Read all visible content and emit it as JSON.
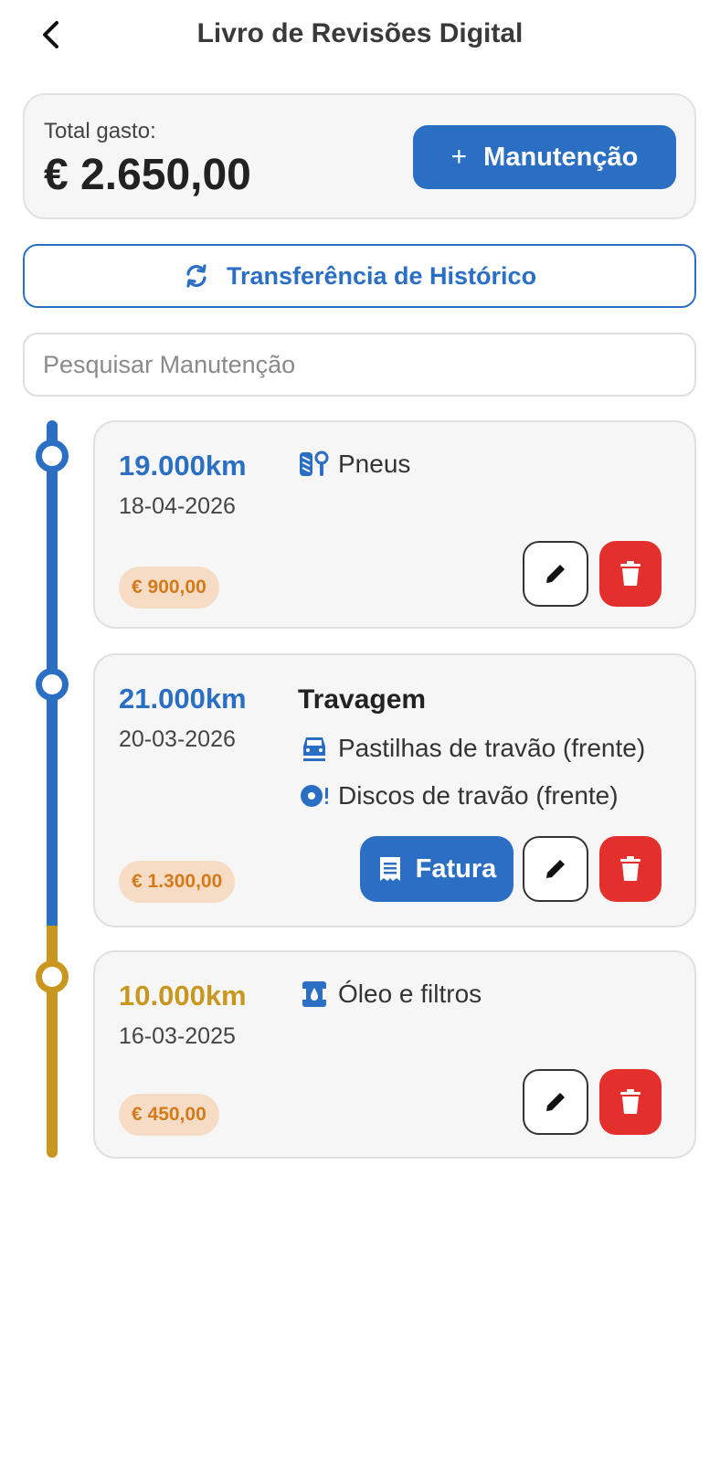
{
  "header": {
    "title": "Livro de Revisões Digital"
  },
  "summary": {
    "total_label": "Total gasto:",
    "total_value": "€ 2.650,00",
    "add_label": "Manutenção"
  },
  "transfer": {
    "label": "Transferência de Histórico"
  },
  "search": {
    "placeholder": "Pesquisar Manutenção",
    "value": ""
  },
  "colors": {
    "primary": "#2a6fc4",
    "gold": "#c9971e",
    "danger": "#e3302c",
    "price_bg": "#f7dcc5",
    "price_text": "#d37a1b"
  },
  "records": [
    {
      "km": "19.000km",
      "date": "18-04-2026",
      "items": [
        {
          "icon": "tire-wrench-icon",
          "label": "Pneus"
        }
      ],
      "price": "€ 900,00"
    },
    {
      "km": "21.000km",
      "date": "20-03-2026",
      "group_title": "Travagem",
      "items": [
        {
          "icon": "car-brake-pads-icon",
          "label": "Pastilhas de travão (frente)"
        },
        {
          "icon": "brake-disc-icon",
          "label": "Discos de travão (frente)"
        }
      ],
      "price": "€ 1.300,00",
      "invoice_label": "Fatura"
    },
    {
      "km": "10.000km",
      "date": "16-03-2025",
      "items": [
        {
          "icon": "oil-filter-icon",
          "label": "Óleo e filtros"
        }
      ],
      "price": "€ 450,00"
    }
  ]
}
